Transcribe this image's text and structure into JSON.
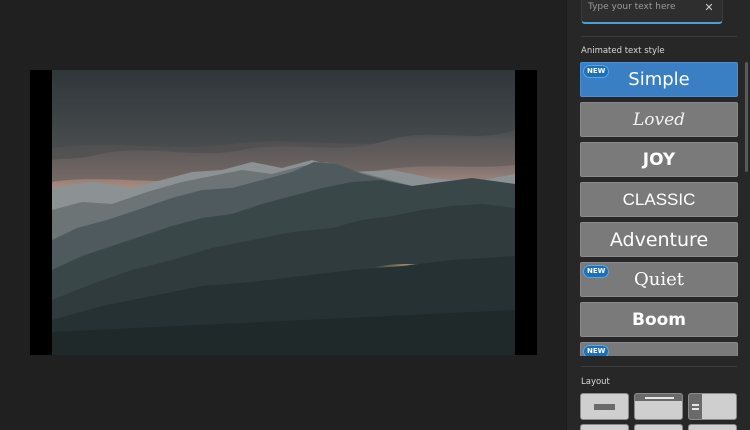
{
  "text_input": {
    "placeholder": "Type your text here",
    "value": ""
  },
  "icons": {
    "clear": "close-icon"
  },
  "sections": {
    "animated_text_style": "Animated text style",
    "layout": "Layout"
  },
  "styles": [
    {
      "label": "Simple",
      "new": true,
      "selected": true
    },
    {
      "label": "Loved",
      "new": false,
      "selected": false
    },
    {
      "label": "JOY",
      "new": false,
      "selected": false
    },
    {
      "label": "CLASSIC",
      "new": false,
      "selected": false
    },
    {
      "label": "Adventure",
      "new": false,
      "selected": false
    },
    {
      "label": "Quiet",
      "new": true,
      "selected": false
    },
    {
      "label": "Boom",
      "new": false,
      "selected": false
    },
    {
      "label": "",
      "new": true,
      "selected": false
    }
  ],
  "badge_label": "NEW",
  "colors": {
    "accent": "#3a7fc3",
    "input_underline": "#4a9fd8",
    "tile": "#7a7a7a"
  }
}
